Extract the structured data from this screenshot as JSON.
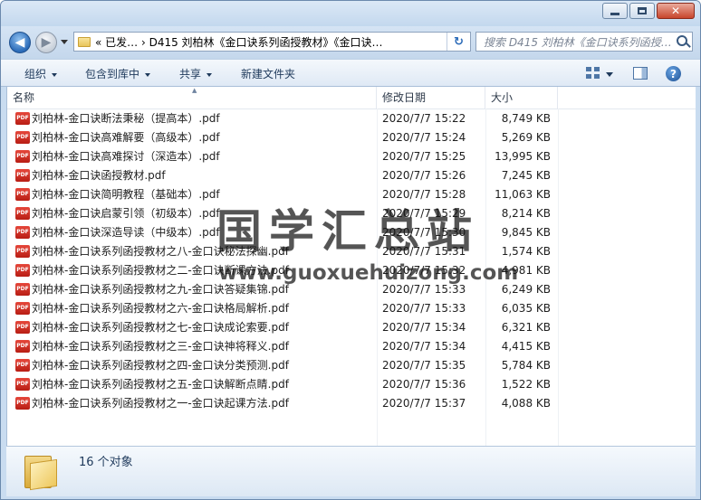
{
  "window": {
    "address_path": "«  已发…  ›  D415 刘柏林《金口诀系列函授教材》《金口诀…",
    "search_placeholder": "搜索 D415 刘柏林《金口诀系列函授…",
    "close_glyph": "✕"
  },
  "toolbar": {
    "organize": "组织",
    "include_in_library": "包含到库中",
    "share": "共享",
    "new_folder": "新建文件夹"
  },
  "columns": {
    "name": "名称",
    "date": "修改日期",
    "size": "大小"
  },
  "files": [
    {
      "name": "刘柏林-金口诀断法秉秘（提高本）.pdf",
      "date": "2020/7/7 15:22",
      "size": "8,749 KB"
    },
    {
      "name": "刘柏林-金口诀高难解要（高级本）.pdf",
      "date": "2020/7/7 15:24",
      "size": "5,269 KB"
    },
    {
      "name": "刘柏林-金口诀高难探讨（深造本）.pdf",
      "date": "2020/7/7 15:25",
      "size": "13,995 KB"
    },
    {
      "name": "刘柏林-金口诀函授教材.pdf",
      "date": "2020/7/7 15:26",
      "size": "7,245 KB"
    },
    {
      "name": "刘柏林-金口诀简明教程（基础本）.pdf",
      "date": "2020/7/7 15:28",
      "size": "11,063 KB"
    },
    {
      "name": "刘柏林-金口诀启蒙引领（初级本）.pdf",
      "date": "2020/7/7 15:29",
      "size": "8,214 KB"
    },
    {
      "name": "刘柏林-金口诀深造导读（中级本）.pdf",
      "date": "2020/7/7 15:30",
      "size": "9,845 KB"
    },
    {
      "name": "刘柏林-金口诀系列函授教材之八-金口诀秘法探幽.pdf",
      "date": "2020/7/7 15:31",
      "size": "1,574 KB"
    },
    {
      "name": "刘柏林-金口诀系列函授教材之二-金口诀断课方法.pdf",
      "date": "2020/7/7 15:32",
      "size": "4,981 KB"
    },
    {
      "name": "刘柏林-金口诀系列函授教材之九-金口诀答疑集锦.pdf",
      "date": "2020/7/7 15:33",
      "size": "6,249 KB"
    },
    {
      "name": "刘柏林-金口诀系列函授教材之六-金口诀格局解析.pdf",
      "date": "2020/7/7 15:33",
      "size": "6,035 KB"
    },
    {
      "name": "刘柏林-金口诀系列函授教材之七-金口诀成论索要.pdf",
      "date": "2020/7/7 15:34",
      "size": "6,321 KB"
    },
    {
      "name": "刘柏林-金口诀系列函授教材之三-金口诀神将释义.pdf",
      "date": "2020/7/7 15:34",
      "size": "4,415 KB"
    },
    {
      "name": "刘柏林-金口诀系列函授教材之四-金口诀分类预测.pdf",
      "date": "2020/7/7 15:35",
      "size": "5,784 KB"
    },
    {
      "name": "刘柏林-金口诀系列函授教材之五-金口诀解断点睛.pdf",
      "date": "2020/7/7 15:36",
      "size": "1,522 KB"
    },
    {
      "name": "刘柏林-金口诀系列函授教材之一-金口诀起课方法.pdf",
      "date": "2020/7/7 15:37",
      "size": "4,088 KB"
    }
  ],
  "watermark": {
    "cn": "国学汇总站",
    "en": "www.guoxuehuizong.com"
  },
  "status": {
    "count_text": "16 个对象"
  },
  "icons": {
    "file_icon_label": "PDF",
    "help": "?",
    "refresh": "↻",
    "back": "◀",
    "forward": "▶"
  }
}
